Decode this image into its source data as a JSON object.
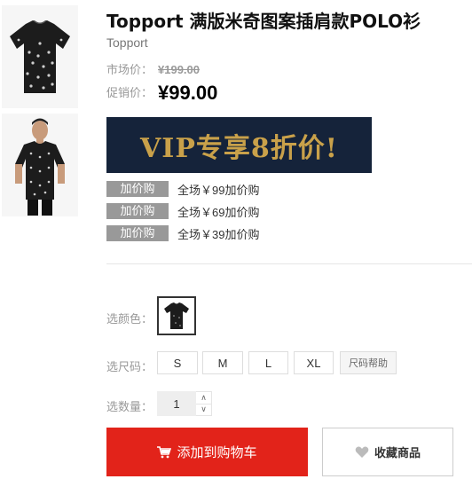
{
  "product": {
    "title": "Topport 满版米奇图案插肩款POLO衫",
    "brand": "Topport"
  },
  "pricing": {
    "market_label": "市场价：",
    "market_price": "¥199.00",
    "promo_label": "促销价：",
    "promo_price": "¥99.00"
  },
  "vip_banner": {
    "text": "VIP专享8折价!"
  },
  "add_buy": [
    {
      "tag": "加价购",
      "text": "全场￥99加价购"
    },
    {
      "tag": "加价购",
      "text": "全场￥69加价购"
    },
    {
      "tag": "加价购",
      "text": "全场￥39加价购"
    }
  ],
  "options": {
    "color_label": "选颜色：",
    "size_label": "选尺码：",
    "sizes": [
      "S",
      "M",
      "L",
      "XL"
    ],
    "size_help": "尺码帮助",
    "qty_label": "选数量：",
    "qty_value": "1"
  },
  "actions": {
    "add_to_cart": "添加到购物车",
    "favorite": "收藏商品"
  },
  "colors": {
    "accent": "#e2231a",
    "tag_bg": "#999999",
    "banner_bg": "#15233a",
    "banner_text": "#c9a14a"
  },
  "icons": [
    "cart-icon",
    "heart-icon",
    "chevron-up-icon",
    "chevron-down-icon"
  ]
}
